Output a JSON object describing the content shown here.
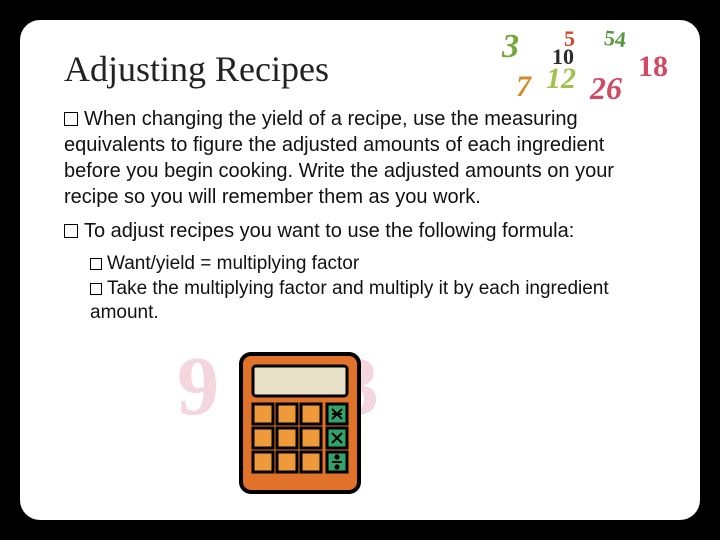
{
  "title": "Adjusting Recipes",
  "bullets": {
    "p1": "When changing the yield of a recipe, use the measuring equivalents to figure the adjusted amounts of each ingredient before you begin cooking. Write the adjusted amounts on your recipe so you will remember them as you work.",
    "p2": "To adjust recipes you want to use the following formula:",
    "s1": "Want/yield = multiplying factor",
    "s2": "Take the multiplying factor and multiply it by each ingredient amount."
  },
  "deco": {
    "n3": "3",
    "n5": "5",
    "n10": "10",
    "n54": "54",
    "n18": "18",
    "n7": "7",
    "n12": "12",
    "n26": "26"
  },
  "fadedDigits": {
    "left": "9",
    "right": "3"
  }
}
